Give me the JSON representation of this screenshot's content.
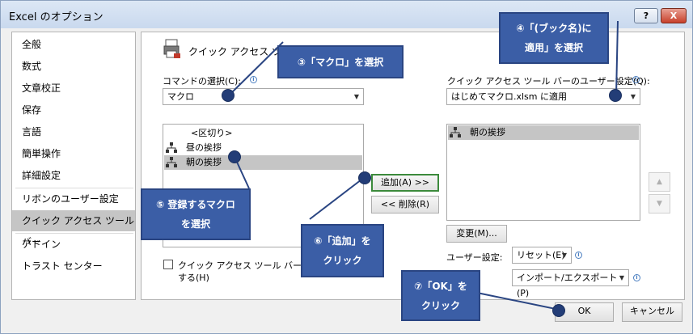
{
  "window": {
    "title": "Excel のオプション",
    "help_label": "?",
    "close_label": "X"
  },
  "nav": {
    "items": [
      "全般",
      "数式",
      "文章校正",
      "保存",
      "言語",
      "簡単操作",
      "詳細設定",
      "リボンのユーザー設定",
      "クイック アクセス ツール バー",
      "アドイン",
      "トラスト センター"
    ],
    "selected": "クイック アクセス ツール バー"
  },
  "content": {
    "header": "クイック アクセス ツール バー",
    "commands_label": "コマンドの選択(C):",
    "commands_value": "マクロ",
    "customize_label": "クイック アクセス ツール バーのユーザー設定(Q):",
    "customize_value": "はじめてマクロ.xlsm に適用",
    "left_list": [
      "<区切り>",
      "昼の挨拶",
      "朝の挨拶"
    ],
    "left_selected": "朝の挨拶",
    "right_list": [
      "朝の挨拶"
    ],
    "add_button": "追加(A) >>",
    "remove_button": "<< 削除(R)",
    "modify_button": "変更(M)...",
    "user_settings_label": "ユーザー設定:",
    "reset_button": "リセット(E)",
    "import_export_button": "インポート/エクスポート(P)",
    "checkbox_line1": "クイック アクセス ツール バーをリボ",
    "checkbox_line2": "する(H)",
    "ok_button": "OK",
    "cancel_button": "キャンセル",
    "up_arrow": "▲",
    "down_arrow": "▼"
  },
  "callouts": {
    "c3": "③「マクロ」を選択",
    "c4": "④「(ブック名)に\n適用」を選択",
    "c5": "⑤ 登録するマクロ\nを選択",
    "c6": "⑥「追加」を\nクリック",
    "c7": "⑦「OK」を\nクリック"
  },
  "colors": {
    "callout_fill": "#3b5ea6",
    "dot": "#233d77",
    "selection": "#c5c5c5"
  }
}
